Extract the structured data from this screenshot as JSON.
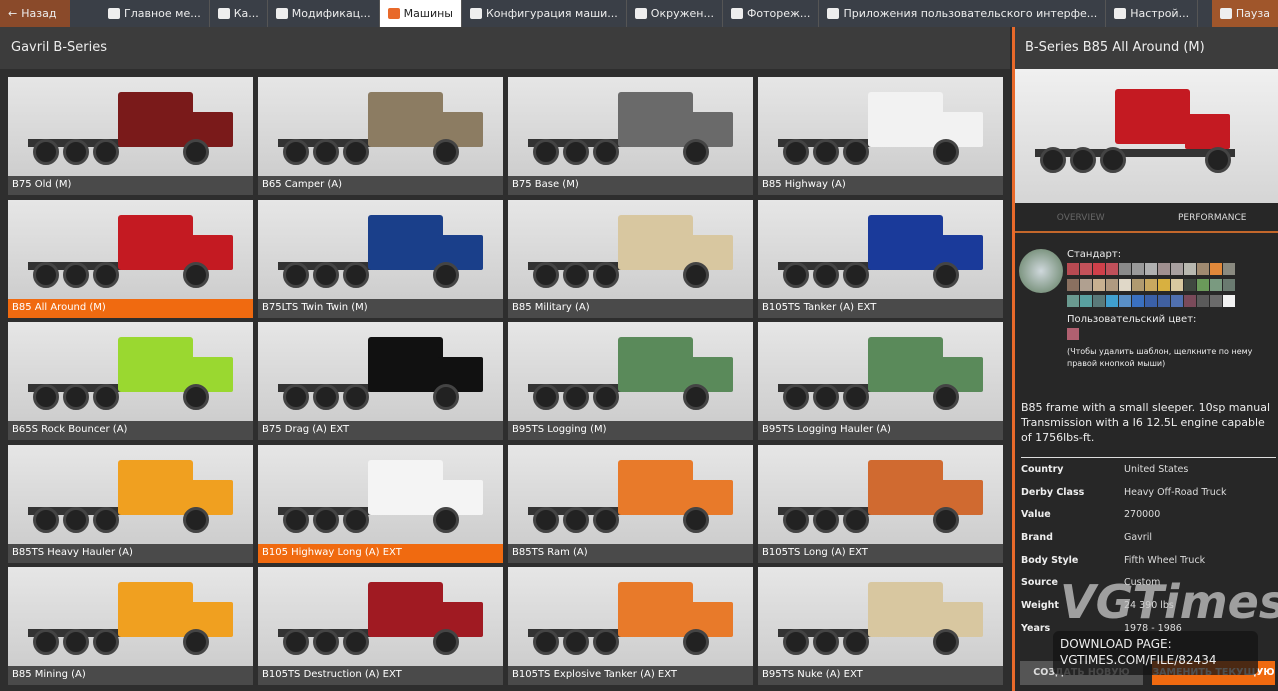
{
  "topbar": {
    "back": "Назад",
    "tabs": [
      "Главное ме...",
      "Ка...",
      "Модификац...",
      "Машины",
      "Конфигурация маши...",
      "Окружен...",
      "Фотореж...",
      "Приложения пользовательского интерфе...",
      "Настрой..."
    ],
    "active": 3,
    "pause": "Пауза"
  },
  "left": {
    "title": "Gavril B-Series"
  },
  "vehicles": [
    {
      "label": "B75 Old (M)",
      "color": "#7a1a1a"
    },
    {
      "label": "B65 Camper (A)",
      "color": "#8c7c62"
    },
    {
      "label": "B75 Base (M)",
      "color": "#6a6a6a"
    },
    {
      "label": "B85 Highway (A)",
      "color": "#f2f2f2"
    },
    {
      "label": "B85 All Around (M)",
      "color": "#c41a22",
      "selected": true
    },
    {
      "label": "B75LTS Twin Twin (M)",
      "color": "#1a3f8a"
    },
    {
      "label": "B85 Military (A)",
      "color": "#d8c7a0"
    },
    {
      "label": "B105TS Tanker (A) EXT",
      "color": "#1a3a9a"
    },
    {
      "label": "B65S Rock Bouncer (A)",
      "color": "#9ad830"
    },
    {
      "label": "B75 Drag (A) EXT",
      "color": "#111111"
    },
    {
      "label": "B95TS Logging (M)",
      "color": "#5a8a5a"
    },
    {
      "label": "B95TS Logging Hauler (A)",
      "color": "#5a8a5a"
    },
    {
      "label": "B85TS Heavy Hauler (A)",
      "color": "#f0a020"
    },
    {
      "label": "B105 Highway Long (A) EXT",
      "color": "#f4f4f4",
      "selected": true
    },
    {
      "label": "B85TS Ram (A)",
      "color": "#e87a2a"
    },
    {
      "label": "B105TS Long (A) EXT",
      "color": "#d06a30"
    },
    {
      "label": "B85 Mining (A)",
      "color": "#f0a020"
    },
    {
      "label": "B105TS Destruction (A) EXT",
      "color": "#a01a22"
    },
    {
      "label": "B105TS Explosive Tanker (A) EXT",
      "color": "#e87a2a"
    },
    {
      "label": "B95TS Nuke (A) EXT",
      "color": "#d8c7a0"
    }
  ],
  "right": {
    "title": "B-Series B85 All Around (M)",
    "tabs": [
      "OVERVIEW",
      "PERFORMANCE"
    ],
    "paint_standard_label": "Стандарт:",
    "paint_custom_label": "Пользовательский цвет:",
    "paint_hint": "(Чтобы удалить шаблон, щелкните по нему правой кнопкой мыши)",
    "swatches": [
      "#b84a52",
      "#c4525a",
      "#d0404a",
      "#c0505a",
      "#8a8a8a",
      "#9a9a9a",
      "#b0b0b0",
      "#a09090",
      "#a8a0a0",
      "#b8b8b0",
      "#a08a70",
      "#e0883a",
      "#8a8a80",
      "#8a7060",
      "#b0a090",
      "#c8b090",
      "#b09a80",
      "#e0d8c8",
      "#b09a70",
      "#c8a860",
      "#d8b040",
      "#d8c8a0",
      "#404840",
      "#6a9a5a",
      "#7a9a80",
      "#6a7a70",
      "#6a9a90",
      "#5aa0a0",
      "#5a7a7a",
      "#40a0d0",
      "#5a90c8",
      "#3a70c0",
      "#3a60a8",
      "#4060a0",
      "#5070b0",
      "#7a4a5a",
      "#5a5a5a",
      "#6a6a6a",
      "#f2f2f2"
    ],
    "custom_swatch": "#b06070",
    "description": "B85 frame with a small sleeper. 10sp manual Transmission with a I6 12.5L engine capable of 1756lbs-ft.",
    "props": [
      [
        "Country",
        "United States"
      ],
      [
        "Derby Class",
        "Heavy Off-Road Truck"
      ],
      [
        "Value",
        "270000"
      ],
      [
        "Brand",
        "Gavril"
      ],
      [
        "Body Style",
        "Fifth Wheel Truck"
      ],
      [
        "Source",
        "Custom"
      ],
      [
        "Weight",
        "24 390 lbs"
      ],
      [
        "Years",
        "1978 - 1986"
      ]
    ],
    "btn_new": "СОЗДАТЬ НОВУЮ",
    "btn_replace": "ЗАМЕНИТЬ ТЕКУЩУЮ"
  },
  "watermark": {
    "logo": "VGTimes",
    "line1": "DOWNLOAD PAGE:",
    "line2": "VGTIMES.COM/FILE/82434"
  },
  "colors": {
    "accent": "#e8692a"
  }
}
